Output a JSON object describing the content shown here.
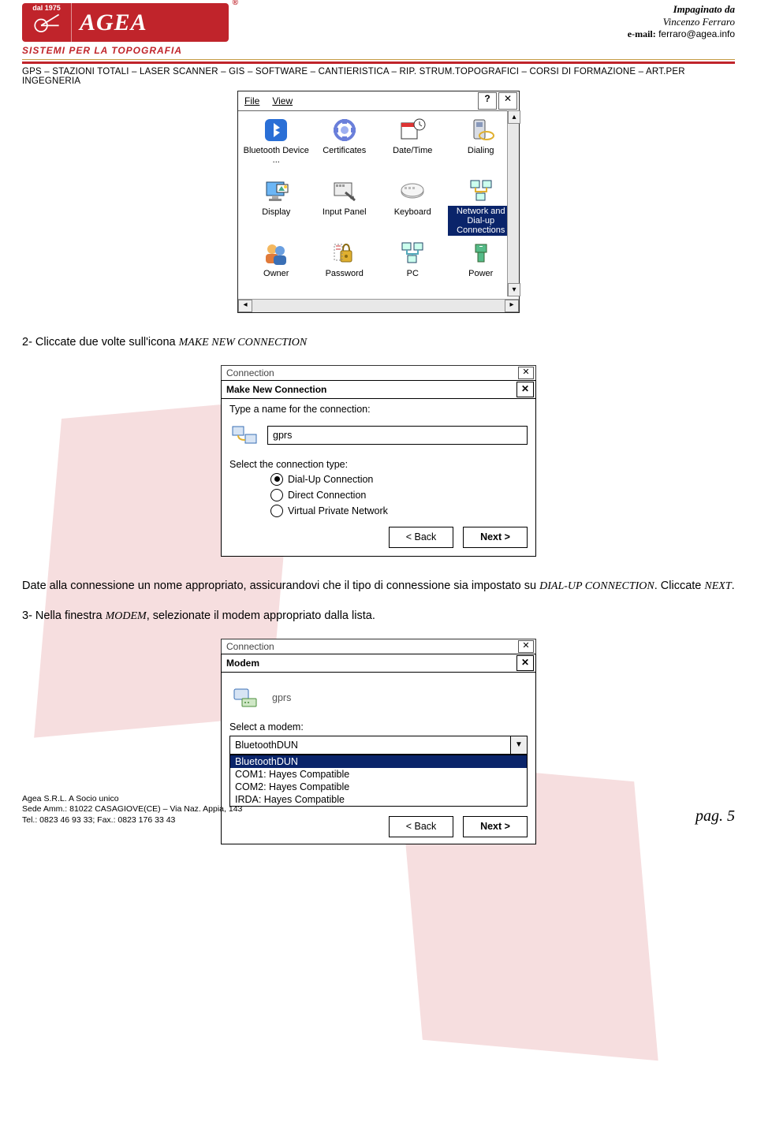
{
  "header": {
    "since": "dal 1975",
    "brand": "AGEA",
    "r": "®",
    "tagline": "SISTEMI  PER  LA  TOPOGRAFIA",
    "credit1": "Impaginato da",
    "credit2": "Vincenzo Ferraro",
    "credit3_label": "e-mail:",
    "credit3_value": "ferraro@agea.info",
    "crumb": "GPS – STAZIONI TOTALI – LASER SCANNER – GIS – SOFTWARE – CANTIERISTICA – RIP. STRUM.TOPOGRAFICI – CORSI DI FORMAZIONE – ART.PER INGEGNERIA"
  },
  "control_panel": {
    "menu_file": "File",
    "menu_view": "View",
    "items": [
      {
        "label": "Bluetooth Device ..."
      },
      {
        "label": "Certificates"
      },
      {
        "label": "Date/Time"
      },
      {
        "label": "Dialing"
      },
      {
        "label": "Display"
      },
      {
        "label": "Input Panel"
      },
      {
        "label": "Keyboard"
      },
      {
        "label": "Network and Dial-up Connections",
        "selected": true
      },
      {
        "label": "Owner"
      },
      {
        "label": "Password"
      },
      {
        "label": "PC"
      },
      {
        "label": "Power"
      }
    ]
  },
  "step2": {
    "intro_a": "2- Cliccate due volte sull'icona ",
    "intro_b": "MAKE NEW CONNECTION",
    "bar_label": "Connection",
    "title": "Make New Connection",
    "prompt": "Type a name for the connection:",
    "value": "gprs",
    "select_label": "Select the connection type:",
    "opt1": "Dial-Up Connection",
    "opt2": "Direct Connection",
    "opt3": "Virtual Private Network",
    "back": "< Back",
    "next": "Next >",
    "para_a": "Date alla connessione un nome appropriato, assicurandovi che il tipo di connessione sia impostato su ",
    "para_b": "DIAL-UP CONNECTION",
    "para_c": ". Cliccate ",
    "para_d": "NEXT",
    "para_e": "."
  },
  "step3": {
    "intro_a": "3- Nella finestra ",
    "intro_b": "MODEM",
    "intro_c": ", selezionate il modem appropriato dalla lista.",
    "bar_label": "Connection",
    "title": "Modem",
    "value": "gprs",
    "select_label": "Select a modem:",
    "selected": "BluetoothDUN",
    "options": [
      "BluetoothDUN",
      "COM1: Hayes Compatible",
      "COM2: Hayes Compatible",
      "IRDA: Hayes Compatible"
    ],
    "back": "< Back",
    "next": "Next >"
  },
  "footer": {
    "l1": "Agea S.R.L. A Socio unico",
    "l2": "Sede Amm.: 81022 CASAGIOVE(CE) – Via Naz. Appia, 143",
    "l3": "Tel.: 0823 46 93 33; Fax.: 0823 176 33 43",
    "page": "pag. 5"
  }
}
